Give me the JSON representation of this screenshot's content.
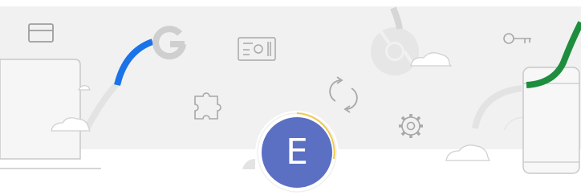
{
  "profile": {
    "avatar_initial": "E",
    "avatar_color": "#5b6fc3",
    "progress_ring_color": "#f2c94c"
  },
  "banner": {
    "background_color": "#f1f1f1",
    "illustration_icons": [
      "credit-card-icon",
      "google-logo-icon",
      "address-card-icon",
      "chrome-logo-icon",
      "key-icon",
      "puzzle-extension-icon",
      "sync-icon",
      "settings-gear-icon",
      "laptop-icon",
      "phone-icon",
      "cloud-icon"
    ],
    "accent_colors": {
      "blue": "#1a73e8",
      "green": "#1e8e3e"
    }
  }
}
